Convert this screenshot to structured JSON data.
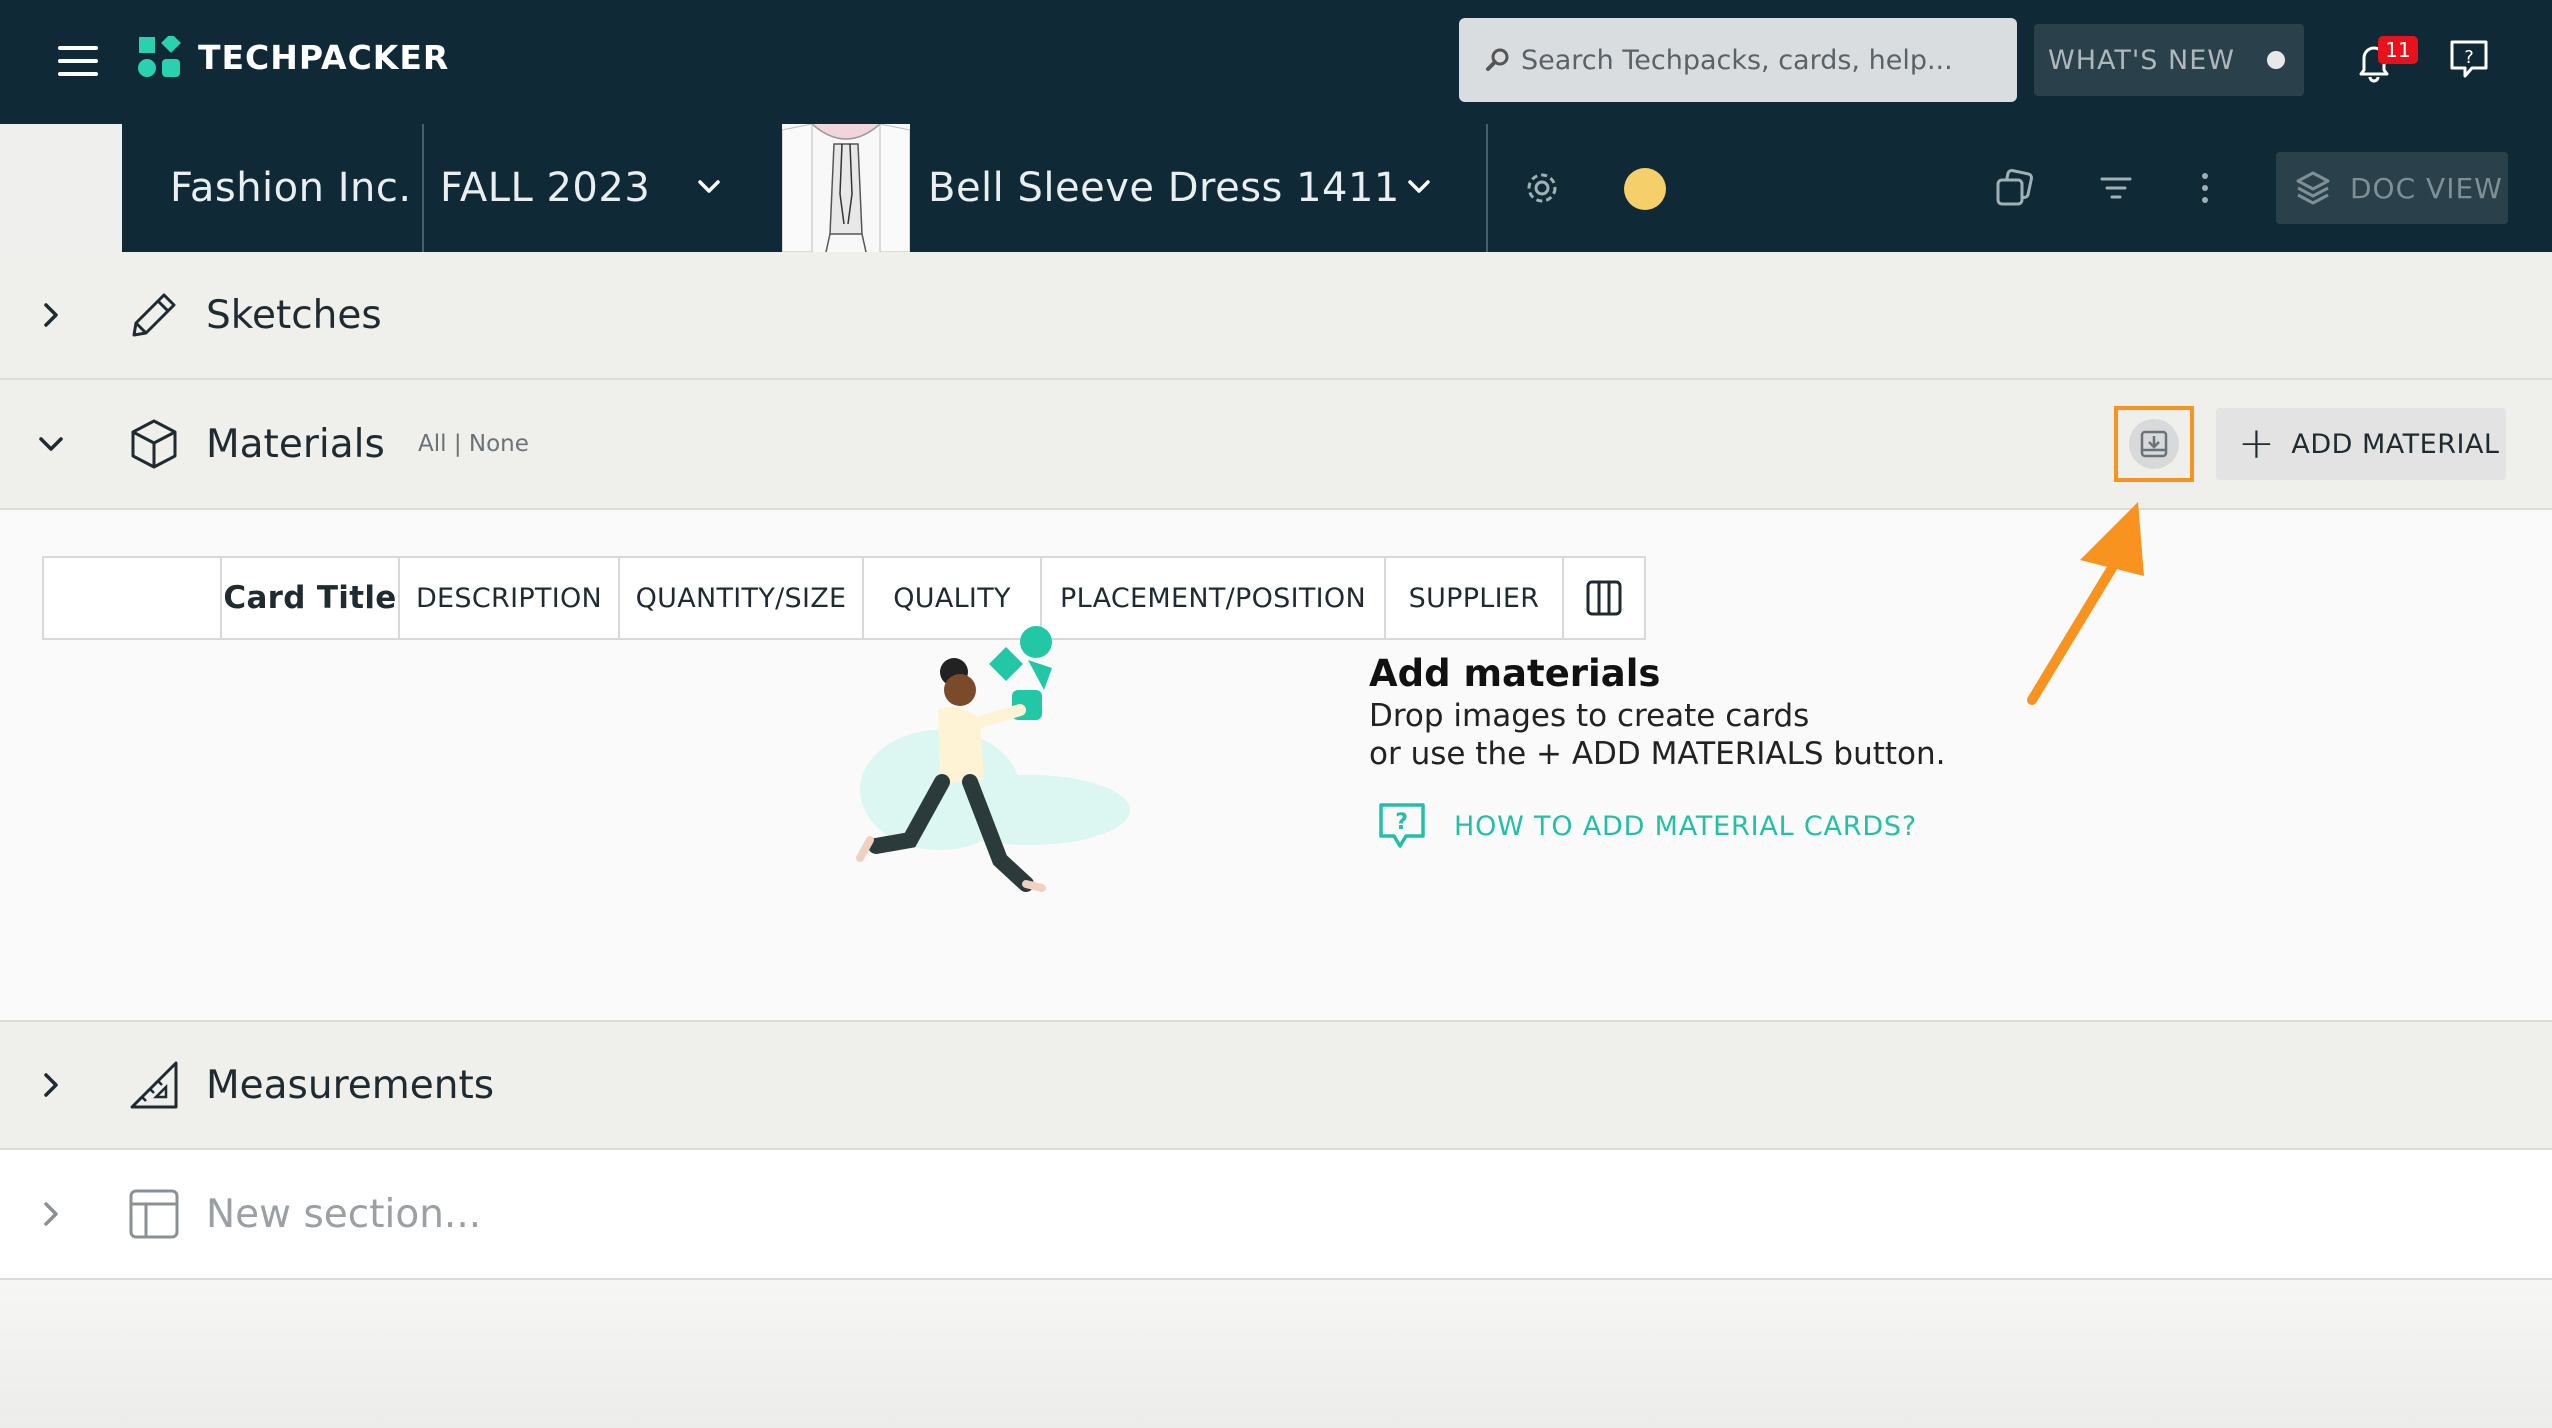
{
  "app": {
    "logo_text": "TECHPACKER",
    "search_placeholder": "Search Techpacks, cards, help...",
    "whats_new_label": "WHAT'S NEW",
    "notification_count": "11"
  },
  "breadcrumb": {
    "company": "Fashion Inc.",
    "season": "FALL 2023",
    "product": "Bell Sleeve Dress 1411",
    "doc_view_label": "DOC VIEW",
    "status_color": "#f4cf6a"
  },
  "sections": {
    "sketches": {
      "title": "Sketches"
    },
    "materials": {
      "title": "Materials",
      "filter_all": "All",
      "filter_sep": " | ",
      "filter_none": "None",
      "add_label": "ADD MATERIAL",
      "columns": [
        "Card Title",
        "DESCRIPTION",
        "QUANTITY/SIZE",
        "QUALITY",
        "PLACEMENT/POSITION",
        "SUPPLIER"
      ],
      "empty_title": "Add materials",
      "empty_line1": "Drop images to create cards",
      "empty_line2": "or use the + ADD MATERIALS button.",
      "help_link": "HOW TO ADD MATERIAL CARDS?"
    },
    "measurements": {
      "title": "Measurements"
    },
    "new_section": {
      "title": "New section..."
    }
  },
  "colors": {
    "header_bg": "#0f2a36",
    "accent_teal": "#22c0a5",
    "highlight_orange": "#f7931e"
  }
}
